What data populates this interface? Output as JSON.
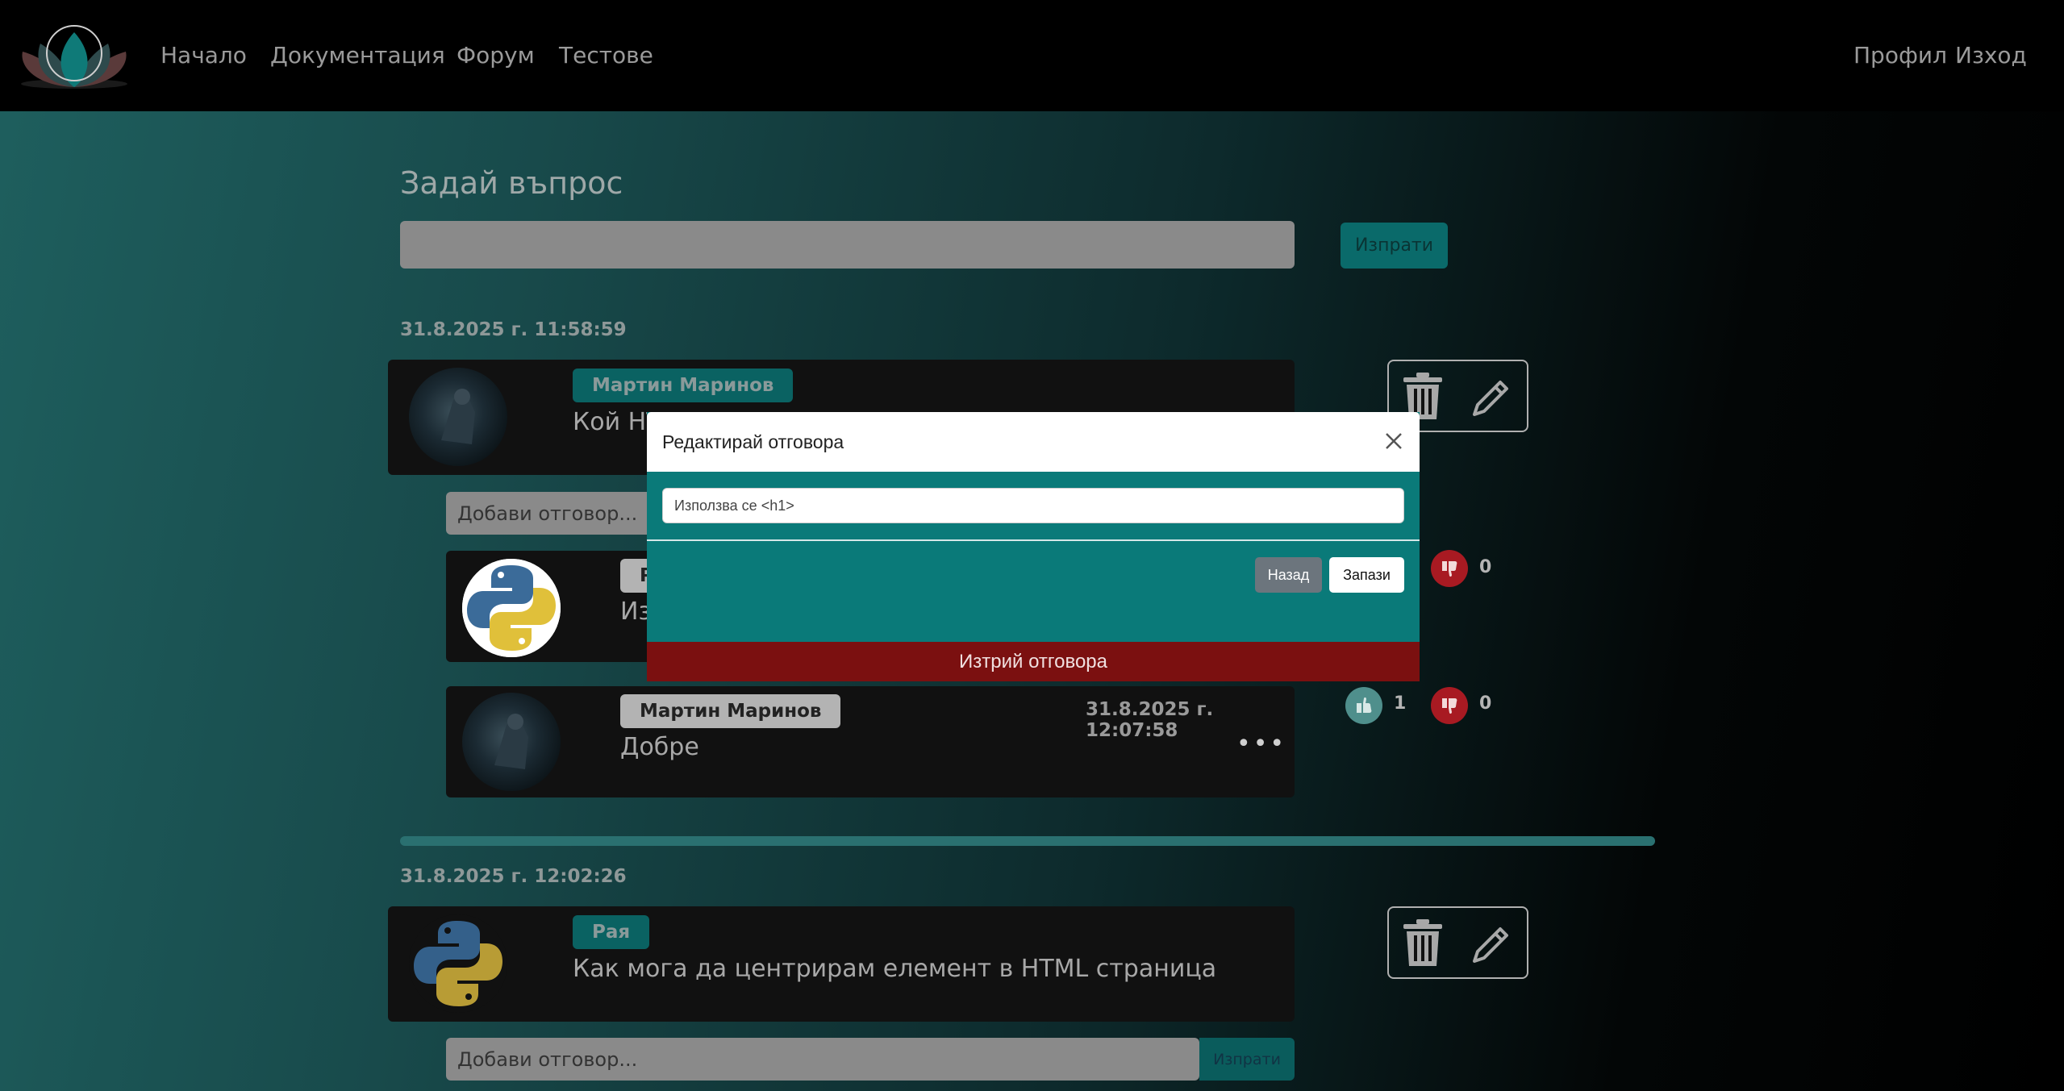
{
  "nav": {
    "links": [
      "Начало",
      "Документация",
      "Форум",
      "Тестове"
    ],
    "profile": "Профил",
    "logout": "Изход"
  },
  "ask": {
    "title": "Задай въпрос",
    "send": "Изпрати"
  },
  "questions": [
    {
      "timestamp": "31.8.2025 г. 11:58:59",
      "author": "Мартин Маринов",
      "text": "Кой HT",
      "answer_placeholder": "Добави отговор...",
      "answers": [
        {
          "author": "Р",
          "text": "Из",
          "likes": "",
          "dislikes": "0"
        },
        {
          "author": "Мартин Маринов",
          "timestamp": "31.8.2025 г. 12:07:58",
          "text": "Добре",
          "likes": "1",
          "dislikes": "0"
        }
      ]
    },
    {
      "timestamp": "31.8.2025 г. 12:02:26",
      "author": "Рая",
      "text": "Как мога да центрирам елемент в HTML страница",
      "answer_placeholder": "Добави отговор...",
      "answer_send": "Изпрати"
    }
  ],
  "modal": {
    "title": "Редактирай отговора",
    "input_value": "Използва се <h1>",
    "back": "Назад",
    "save": "Запази",
    "delete": "Изтрий отговора"
  },
  "colors": {
    "accent": "#0a7a79",
    "danger": "#7b1010",
    "navbar": "#000000"
  }
}
